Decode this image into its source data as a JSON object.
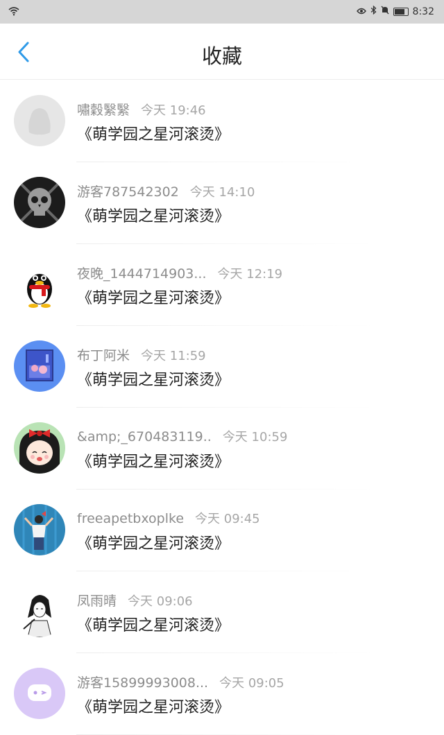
{
  "status_bar": {
    "time": "8:32"
  },
  "header": {
    "title": "收藏"
  },
  "items": [
    {
      "name": "嘯穀繄繄",
      "time": "今天 19:46",
      "work": "《萌学园之星河滚烫》"
    },
    {
      "name": "游客787542302",
      "time": "今天 14:10",
      "work": "《萌学园之星河滚烫》"
    },
    {
      "name": "夜晚_1444714903...",
      "time": "今天 12:19",
      "work": "《萌学园之星河滚烫》"
    },
    {
      "name": "布丁阿米",
      "time": "今天 11:59",
      "work": "《萌学园之星河滚烫》"
    },
    {
      "name": "&amp;_670483119..",
      "time": "今天 10:59",
      "work": "《萌学园之星河滚烫》"
    },
    {
      "name": "freeapetbxoplke",
      "time": "今天 09:45",
      "work": "《萌学园之星河滚烫》"
    },
    {
      "name": "凤雨晴",
      "time": "今天 09:06",
      "work": "《萌学园之星河滚烫》"
    },
    {
      "name": "游客15899993008...",
      "time": "今天 09:05",
      "work": "《萌学园之星河滚烫》"
    }
  ]
}
